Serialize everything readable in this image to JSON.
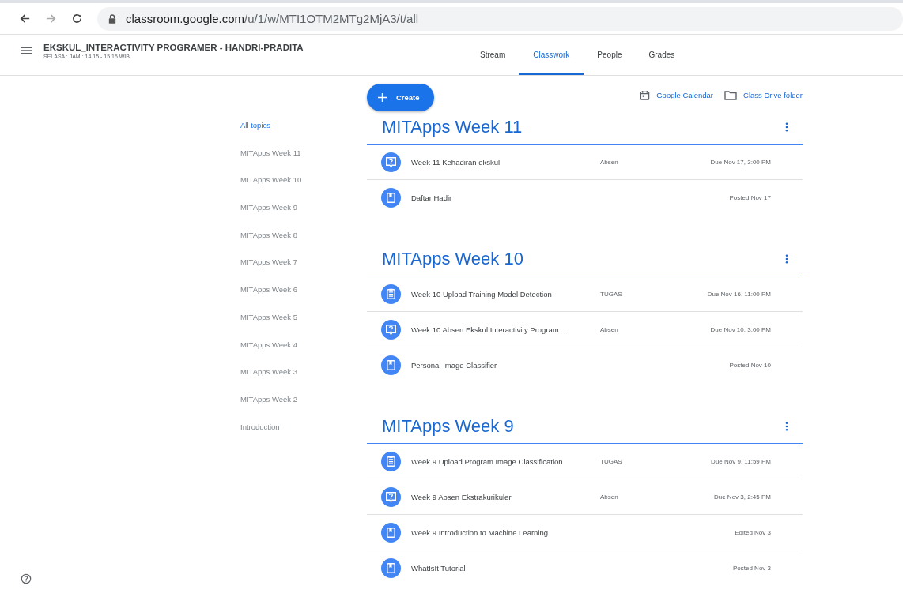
{
  "browser": {
    "url_host": "classroom.google.com",
    "url_path": "/u/1/w/MTI1OTM2MTg2MjA3/t/all"
  },
  "header": {
    "title": "EKSKUL_INTERACTIVITY PROGRAMER - HANDRI-PRADITA",
    "subtitle": "SELASA : JAM : 14.15 - 15.15 WIB"
  },
  "tabs": [
    {
      "label": "Stream",
      "selected": false
    },
    {
      "label": "Classwork",
      "selected": true
    },
    {
      "label": "People",
      "selected": false
    },
    {
      "label": "Grades",
      "selected": false
    }
  ],
  "toolbar": {
    "create": "Create",
    "links": [
      {
        "kind": "calendar",
        "label": "Google Calendar"
      },
      {
        "kind": "folder",
        "label": "Class Drive folder"
      }
    ]
  },
  "topics": [
    {
      "label": "All topics",
      "selected": true
    },
    {
      "label": "MITApps Week 11",
      "selected": false
    },
    {
      "label": "MITApps Week 10",
      "selected": false
    },
    {
      "label": "MITApps Week 9",
      "selected": false
    },
    {
      "label": "MITApps Week 8",
      "selected": false
    },
    {
      "label": "MITApps Week 7",
      "selected": false
    },
    {
      "label": "MITApps Week 6",
      "selected": false
    },
    {
      "label": "MITApps Week 5",
      "selected": false
    },
    {
      "label": "MITApps Week 4",
      "selected": false
    },
    {
      "label": "MITApps Week 3",
      "selected": false
    },
    {
      "label": "MITApps Week 2",
      "selected": false
    },
    {
      "label": "Introduction",
      "selected": false
    }
  ],
  "sections": [
    {
      "title": "MITApps Week 11",
      "items": [
        {
          "kind": "question",
          "title": "Week 11 Kehadiran ekskul",
          "tag": "Absen",
          "date": "Due Nov 17, 3:00 PM"
        },
        {
          "kind": "material",
          "title": "Daftar Hadir",
          "date": "Posted Nov 17"
        }
      ]
    },
    {
      "title": "MITApps Week 10",
      "items": [
        {
          "kind": "assignment",
          "title": "Week 10 Upload Training Model Detection",
          "tag": "TUGAS",
          "date": "Due Nov 16, 11:00 PM"
        },
        {
          "kind": "question",
          "title": "Week 10 Absen Ekskul Interactivity Program...",
          "tag": "Absen",
          "date": "Due Nov 10, 3:00 PM"
        },
        {
          "kind": "material",
          "title": "Personal Image Classifier",
          "date": "Posted Nov 10"
        }
      ]
    },
    {
      "title": "MITApps Week 9",
      "items": [
        {
          "kind": "assignment",
          "title": "Week 9 Upload Program Image Classification",
          "tag": "TUGAS",
          "date": "Due Nov 9, 11:59 PM"
        },
        {
          "kind": "question",
          "title": "Week 9 Absen Ekstrakurikuler",
          "tag": "Absen",
          "date": "Due Nov 3, 2:45 PM"
        },
        {
          "kind": "material",
          "title": "Week 9 Introduction to Machine Learning",
          "date": "Edited Nov 3"
        },
        {
          "kind": "material",
          "title": "WhatIsIt Tutorial",
          "date": "Posted Nov 3"
        }
      ]
    }
  ]
}
